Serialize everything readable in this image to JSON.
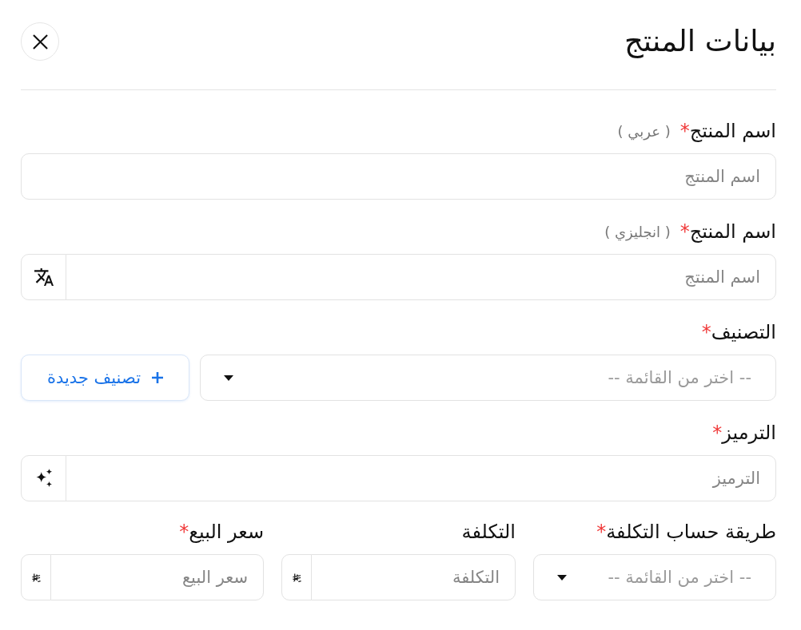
{
  "header": {
    "title": "بيانات المنتج"
  },
  "fields": [
    {
      "kind": "text",
      "label": "اسم المنتج",
      "required_mark": "*",
      "note": "( عربي )",
      "placeholder": "اسم المنتج"
    },
    {
      "kind": "text_translate",
      "label": "اسم المنتج",
      "required_mark": "*",
      "note": "( انجليزي )",
      "placeholder": "اسم المنتج"
    },
    {
      "kind": "select_with_button",
      "label": "التصنيف",
      "required_mark": "*",
      "placeholder": "-- اختر من القائمة --",
      "button": "تصنيف جديدة"
    },
    {
      "kind": "text_generate",
      "label": "الترميز",
      "required_mark": "*",
      "placeholder": "الترميز"
    }
  ],
  "pricing_fields": [
    {
      "kind": "select",
      "label": "طريقة حساب التكلفة",
      "required_mark": "*",
      "placeholder": "-- اختر من القائمة --"
    },
    {
      "kind": "currency",
      "label": "التكلفة",
      "placeholder": "التكلفة"
    },
    {
      "kind": "currency",
      "label": "سعر البيع",
      "required_mark": "*",
      "placeholder": "سعر البيع"
    }
  ]
}
